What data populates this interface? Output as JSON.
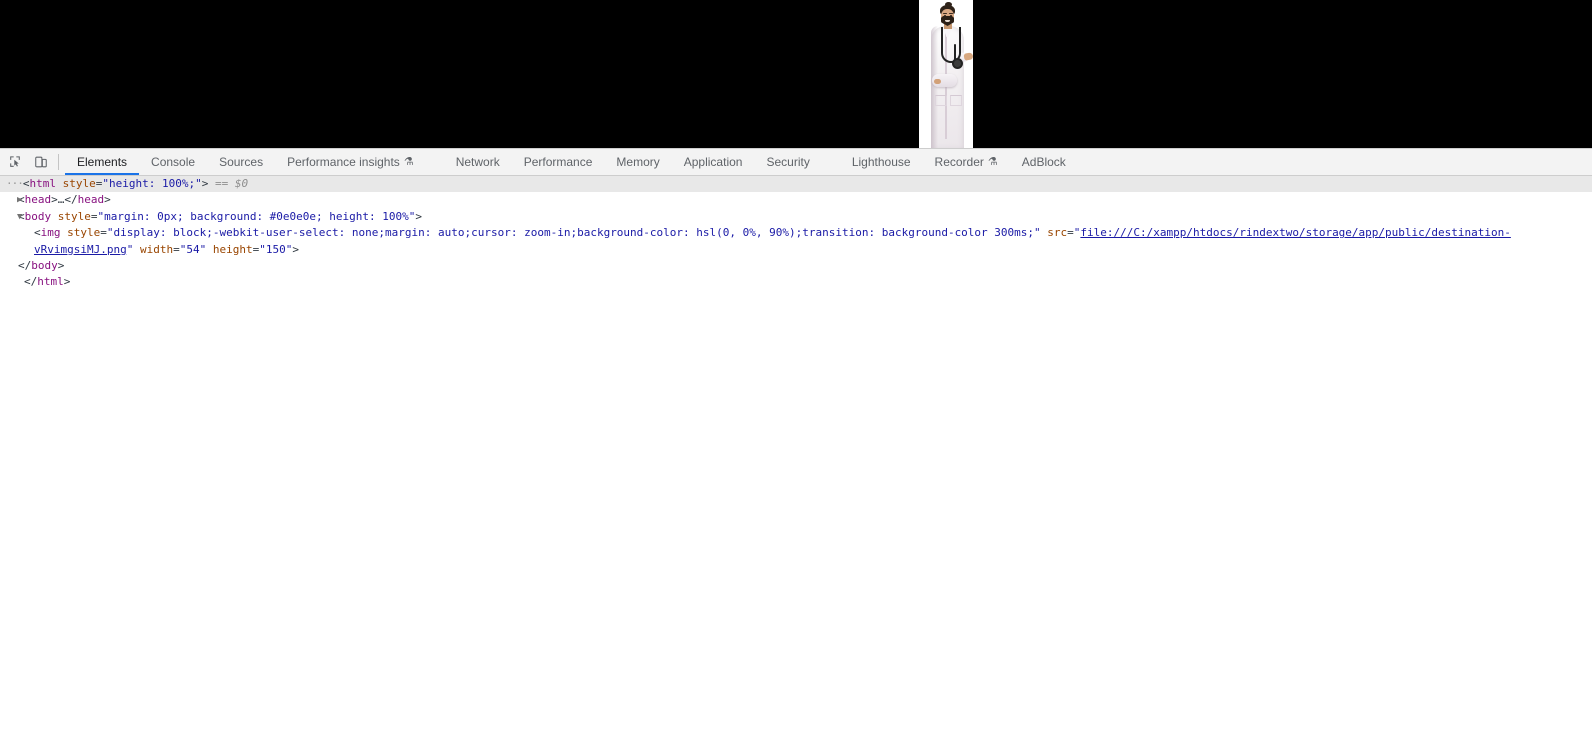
{
  "viewport": {
    "name": "image-preview-page",
    "background_color": "#000000",
    "image": {
      "alt": "doctor-in-white-coat-with-stethoscope",
      "width": "54",
      "height": "150",
      "background_color": "#e6e6e6"
    }
  },
  "devtools": {
    "toolbar": {
      "inspect_icon": "inspect-element-icon",
      "device_icon": "device-toolbar-icon",
      "tabs": [
        {
          "label": "Elements",
          "active": true,
          "experiment": false
        },
        {
          "label": "Console",
          "active": false,
          "experiment": false
        },
        {
          "label": "Sources",
          "active": false,
          "experiment": false
        },
        {
          "label": "Performance insights",
          "active": false,
          "experiment": true
        },
        {
          "label": "Network",
          "active": false,
          "experiment": false
        },
        {
          "label": "Performance",
          "active": false,
          "experiment": false
        },
        {
          "label": "Memory",
          "active": false,
          "experiment": false
        },
        {
          "label": "Application",
          "active": false,
          "experiment": false
        },
        {
          "label": "Security",
          "active": false,
          "experiment": false
        },
        {
          "label": "Lighthouse",
          "active": false,
          "experiment": false
        },
        {
          "label": "Recorder",
          "active": false,
          "experiment": true
        },
        {
          "label": "AdBlock",
          "active": false,
          "experiment": false
        }
      ],
      "experiment_glyph": "⚗",
      "active_tab_color": "#1a73e8"
    },
    "dom": {
      "rows": {
        "html_open": {
          "dots": "···",
          "lt": "<",
          "tag": "html",
          "space": " ",
          "attr_name": "style",
          "eq": "=",
          "attr_val": "\"height: 100%;\"",
          "gt": ">",
          "selected_marker": "== $0"
        },
        "head": {
          "twisty": "▶",
          "open_lt": "<",
          "open_tag": "head",
          "open_gt": ">",
          "ellipsis": "…",
          "close_lt": "</",
          "close_tag": "head",
          "close_gt": ">"
        },
        "body_open": {
          "twisty": "▼",
          "lt": "<",
          "tag": "body",
          "space": " ",
          "attr_name": "style",
          "eq": "=",
          "attr_val": "\"margin: 0px; background: #0e0e0e; height: 100%\"",
          "gt": ">"
        },
        "img": {
          "lt": "<",
          "tag": "img",
          "space": " ",
          "style_name": "style",
          "eq": "=",
          "style_val": "\"display: block;-webkit-user-select: none;margin: auto;cursor: zoom-in;background-color: hsl(0, 0%, 90%);transition: background-color 300ms;\"",
          "src_name": "src",
          "src_eq": "=",
          "src_quote_open": "\"",
          "src_link_part1": "file:///C:/xampp/htdocs/rindextwo/storage/app/public/destination-vRvimgsiMJ.p",
          "src_link_part2": "ng",
          "src_quote_close": "\"",
          "width_name": "width",
          "width_val": "\"54\"",
          "height_name": "height",
          "height_val": "\"150\"",
          "gt": ">"
        },
        "body_close": {
          "lt": "</",
          "tag": "body",
          "gt": ">"
        },
        "html_close": {
          "lt": "</",
          "tag": "html",
          "gt": ">"
        }
      }
    }
  }
}
